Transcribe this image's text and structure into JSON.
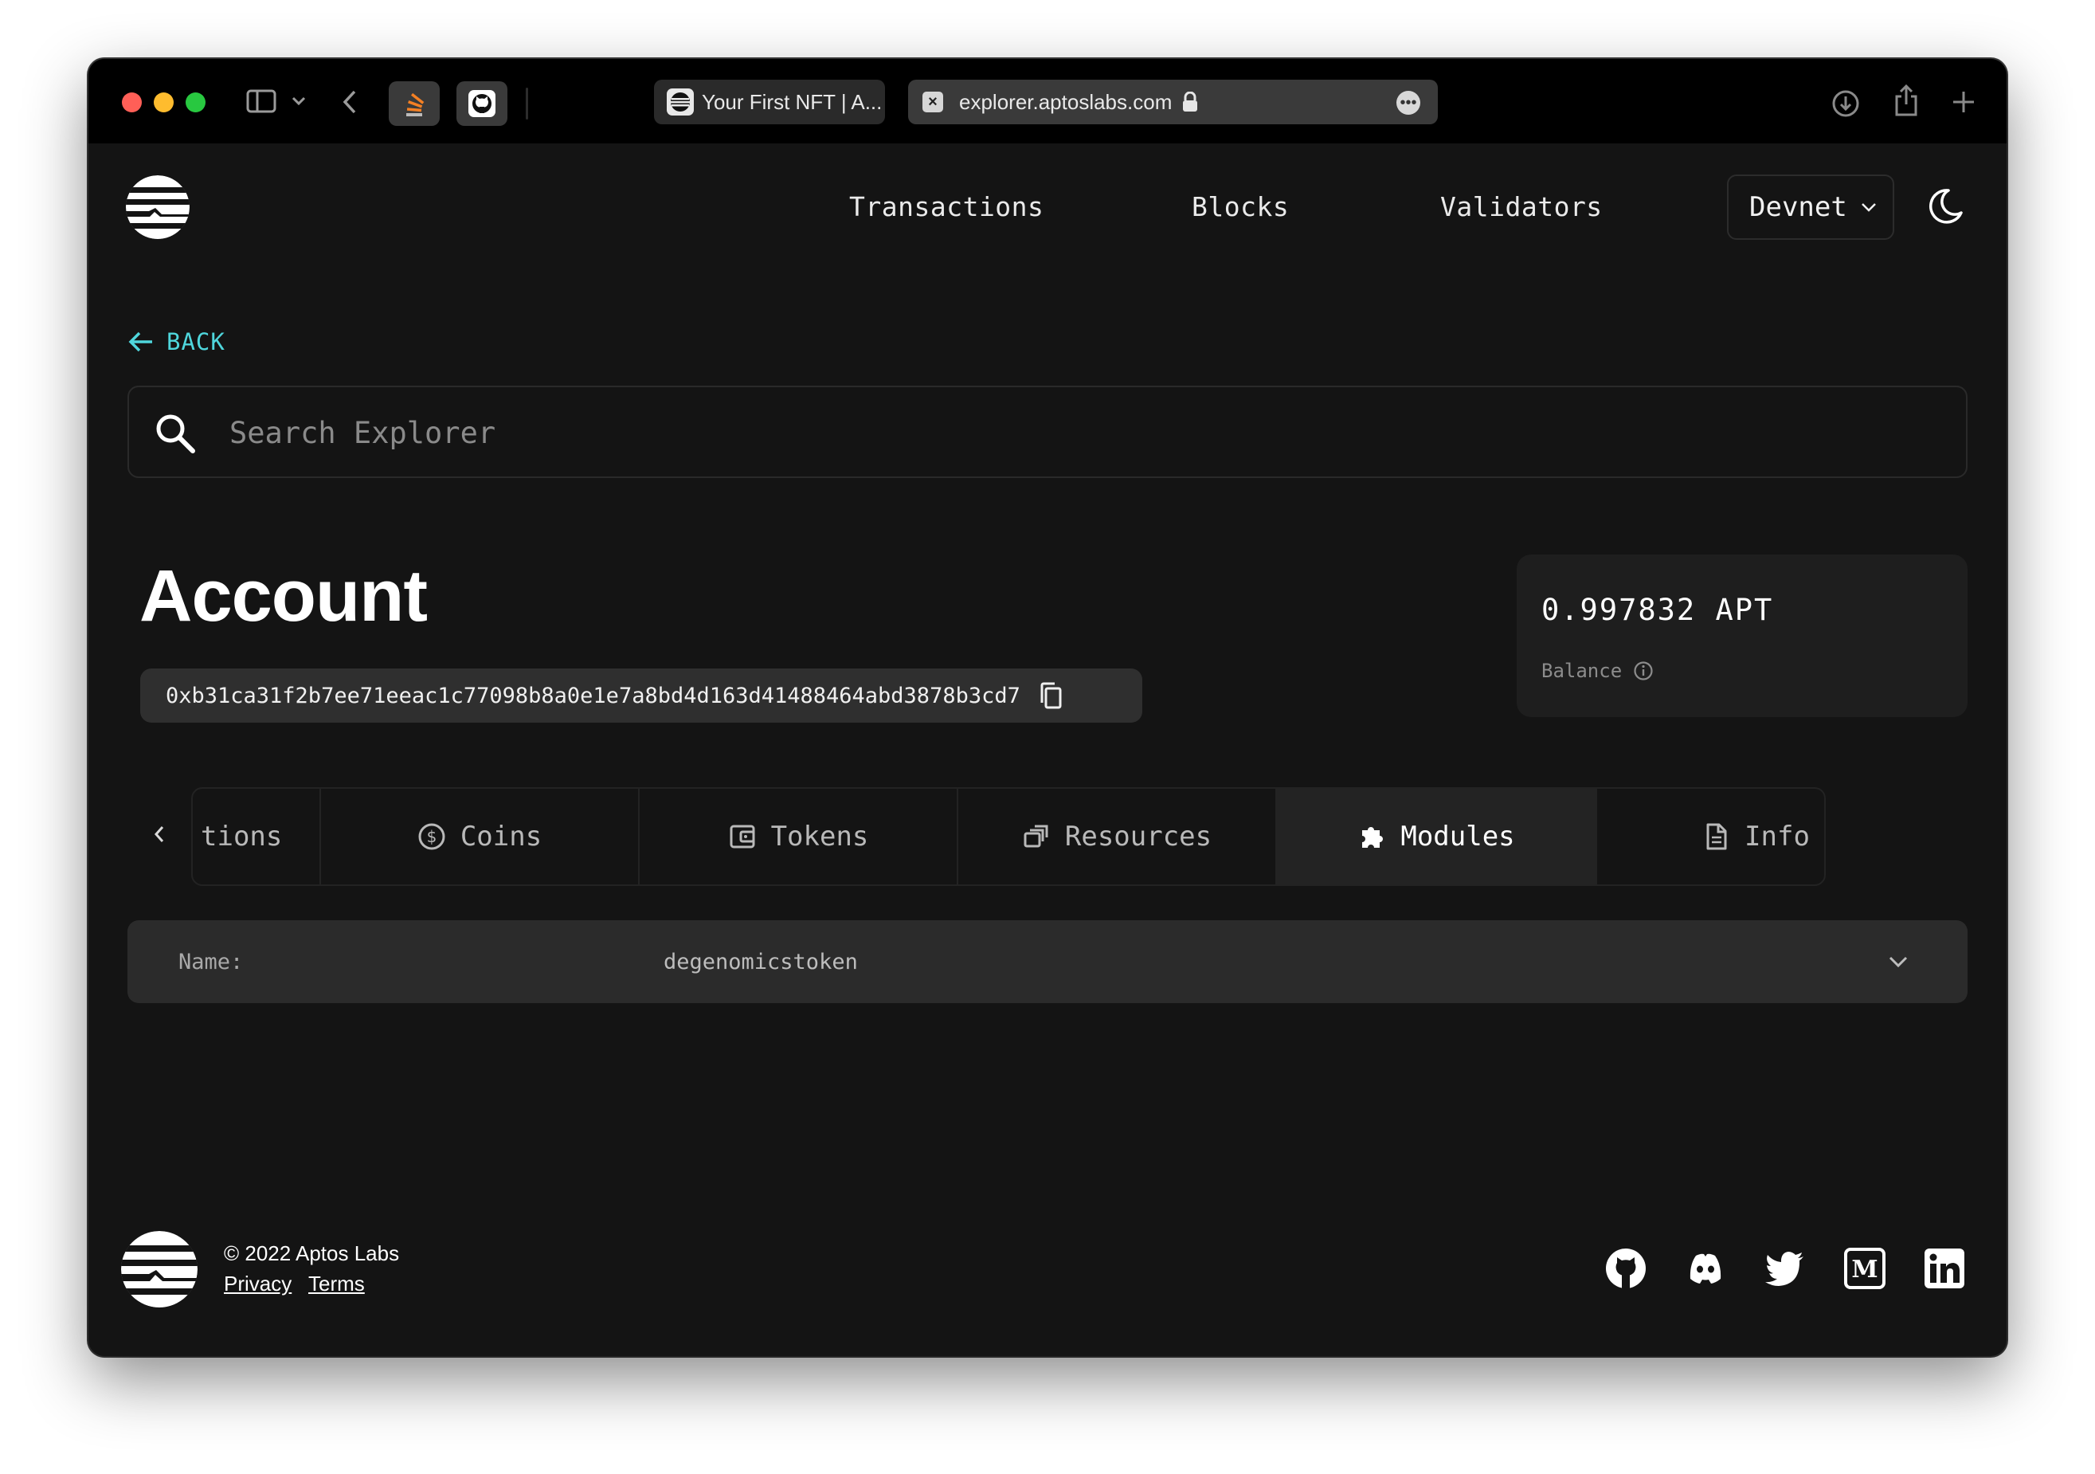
{
  "browser": {
    "inactive_tab_title": "Your First NFT | A...",
    "active_tab_url": "explorer.aptoslabs.com"
  },
  "header": {
    "nav": [
      "Transactions",
      "Blocks",
      "Validators"
    ],
    "network": "Devnet"
  },
  "back_label": "BACK",
  "search": {
    "placeholder": "Search Explorer"
  },
  "account": {
    "title": "Account",
    "address": "0xb31ca31f2b7ee71eeac1c77098b8a0e1e7a8bd4d163d41488464abd3878b3cd7",
    "balance_value": "0.997832 APT",
    "balance_label": "Balance"
  },
  "tabs": {
    "partial": "tions",
    "items": [
      {
        "label": "Coins",
        "icon": "coin-icon"
      },
      {
        "label": "Tokens",
        "icon": "wallet-icon"
      },
      {
        "label": "Resources",
        "icon": "resources-icon"
      },
      {
        "label": "Modules",
        "icon": "puzzle-icon",
        "active": true
      },
      {
        "label": "Info",
        "icon": "document-icon"
      }
    ]
  },
  "module": {
    "name_label": "Name:",
    "name_value": "degenomicstoken"
  },
  "footer": {
    "copyright": "© 2022 Aptos Labs",
    "privacy": "Privacy",
    "terms": "Terms"
  },
  "colors": {
    "background": "#141414",
    "accent": "#4fd6dc",
    "card": "#1e1e1e"
  }
}
